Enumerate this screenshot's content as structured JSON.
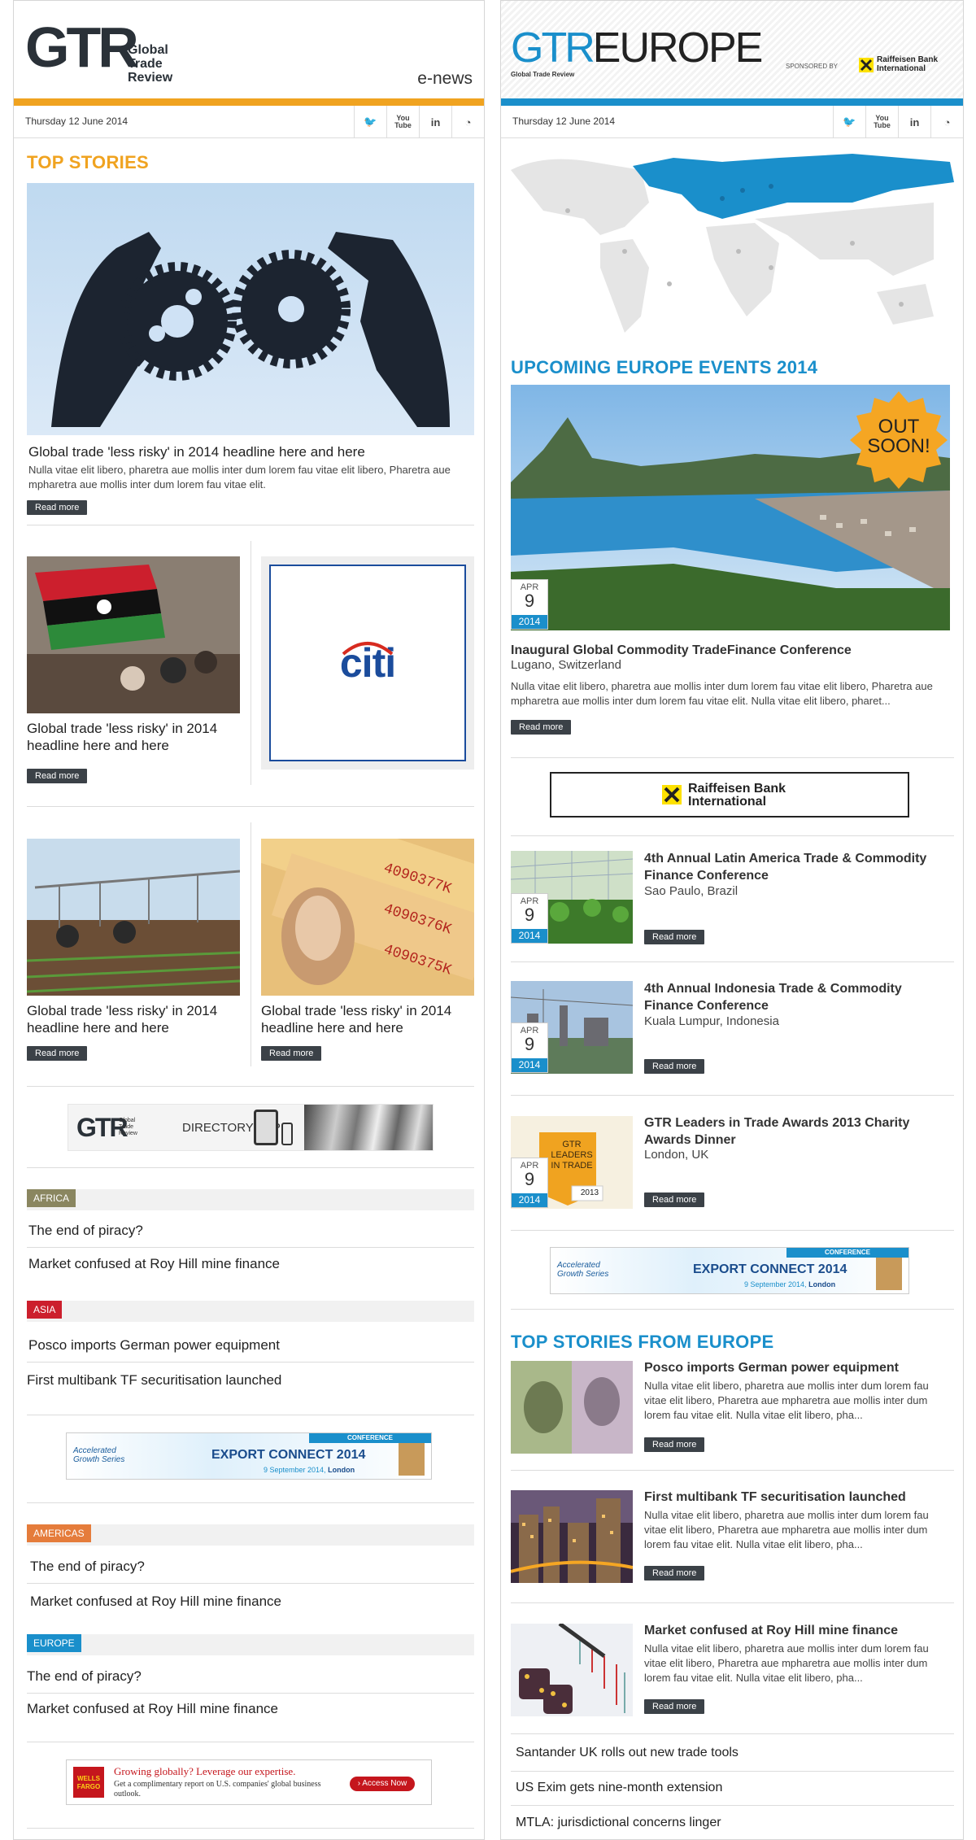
{
  "left": {
    "logo_mark": "GTR",
    "logo_lines": [
      "Global",
      "Trade",
      "Review"
    ],
    "edition": "e-news",
    "date": "Thursday 12 June 2014",
    "social": [
      "twitter-icon",
      "youtube-icon",
      "linkedin-icon",
      "rss-icon"
    ],
    "social_labels": [
      "🐦",
      "You\nTube",
      "in",
      "◔"
    ],
    "top_stories_heading": "TOP STORIES",
    "lead_story": {
      "headline": "Global trade 'less risky' in 2014 headline here and here",
      "body": "Nulla vitae elit libero, pharetra aue mollis inter dum lorem fau vitae elit libero, Pharetra aue mpharetra aue mollis inter dum lorem fau vitae elit.",
      "read_more": "Read more"
    },
    "story_2": {
      "headline": "Global trade 'less risky' in 2014 headline here and here",
      "read_more": "Read more"
    },
    "citi_ad": "citi",
    "story_3": {
      "headline": "Global trade 'less risky' in 2014 headline here and here",
      "read_more": "Read more"
    },
    "story_4": {
      "headline": "Global trade 'less risky' in 2014 headline here and here",
      "read_more": "Read more"
    },
    "directory_banner": {
      "mark": "GTR",
      "small": "Global Trade Review",
      "text": "DIRECTORY APP"
    },
    "regions": [
      {
        "tag": "AFRICA",
        "color": "#8a8660",
        "links": [
          "The end of piracy?",
          "Market confused at Roy Hill mine finance"
        ]
      },
      {
        "tag": "ASIA",
        "color": "#cc1f2d",
        "links": [
          "Posco imports German power equipment",
          "First multibank TF securitisation launched"
        ]
      },
      {
        "tag": "AMERICAS",
        "color": "#e57c3b",
        "links": [
          "The end of piracy?",
          "Market confused at Roy Hill mine finance"
        ]
      },
      {
        "tag": "EUROPE",
        "color": "#1a8fcb",
        "links": [
          "The end of piracy?",
          "Market confused at Roy Hill mine finance"
        ]
      }
    ],
    "export_banner": {
      "label": "CONFERENCE",
      "title": "EXPORT CONNECT 2014",
      "date": "9 September 2014,",
      "city": "London",
      "brand": "Accelerated Growth Series"
    },
    "wells_banner": {
      "logo": "WELLS FARGO",
      "headline": "Growing globally? Leverage our expertise.",
      "sub": "Get a complimentary report on U.S. companies' global business outlook.",
      "cta": "› Access Now"
    }
  },
  "right": {
    "logo_mark": "GTR",
    "logo_word": "EUROPE",
    "logo_sub": "Global Trade Review",
    "sponsored_by": "SPONSORED BY",
    "sponsor": "Raiffeisen Bank International",
    "date": "Thursday 12 June 2014",
    "events_heading": "UPCOMING EUROPE EVENTS 2014",
    "out_soon": [
      "OUT",
      "SOON!"
    ],
    "lead_event": {
      "month": "APR",
      "day": "9",
      "year": "2014",
      "title": "Inaugural Global Commodity TradeFinance Conference",
      "location": "Lugano, Switzerland",
      "body": "Nulla vitae elit libero, pharetra aue mollis inter dum lorem fau vitae elit libero, Pharetra aue mpharetra aue mollis inter dum lorem fau vitae elit. Nulla vitae elit libero, pharet...",
      "read_more": "Read more"
    },
    "sponsor_banner": [
      "Raiffeisen Bank",
      "International"
    ],
    "events": [
      {
        "month": "APR",
        "day": "9",
        "year": "2014",
        "title": "4th Annual Latin America Trade & Commodity Finance Conference",
        "location": "Sao Paulo, Brazil",
        "read_more": "Read more"
      },
      {
        "month": "APR",
        "day": "9",
        "year": "2014",
        "title": "4th Annual Indonesia Trade & Commodity Finance Conference",
        "location": "Kuala Lumpur, Indonesia",
        "read_more": "Read more"
      },
      {
        "month": "APR",
        "day": "9",
        "year": "2014",
        "title": "GTR Leaders in Trade Awards 2013 Charity Awards Dinner",
        "location": "London, UK",
        "read_more": "Read more"
      }
    ],
    "awards_badge": [
      "GTR",
      "LEADERS",
      "IN TRADE",
      "2013"
    ],
    "export_banner": {
      "label": "CONFERENCE",
      "title": "EXPORT CONNECT 2014",
      "date": "9 September 2014,",
      "city": "London",
      "brand": "Accelerated Growth Series"
    },
    "top_stories_heading": "TOP STORIES FROM EUROPE",
    "stories": [
      {
        "title": "Posco imports German power equipment",
        "body": "Nulla vitae elit libero, pharetra aue mollis inter dum lorem fau vitae elit libero, Pharetra aue mpharetra aue mollis inter dum lorem fau vitae elit. Nulla vitae elit libero, pha...",
        "read_more": "Read more"
      },
      {
        "title": "First multibank TF securitisation launched",
        "body": "Nulla vitae elit libero, pharetra aue mollis inter dum lorem fau vitae elit libero, Pharetra aue mpharetra aue mollis inter dum lorem fau vitae elit. Nulla vitae elit libero, pha...",
        "read_more": "Read more"
      },
      {
        "title": "Market confused at Roy Hill mine finance",
        "body": "Nulla vitae elit libero, pharetra aue mollis inter dum lorem fau vitae elit libero, Pharetra aue mpharetra aue mollis inter dum lorem fau vitae elit. Nulla vitae elit libero, pha...",
        "read_more": "Read more"
      }
    ],
    "more_links": [
      "Santander UK rolls out new trade tools",
      "US Exim gets nine-month extension",
      "MTLA: jurisdictional concerns linger"
    ]
  },
  "colors": {
    "gtr_orange": "#f0a320",
    "gtr_blue": "#1a8fcb",
    "dark": "#3b4147"
  }
}
